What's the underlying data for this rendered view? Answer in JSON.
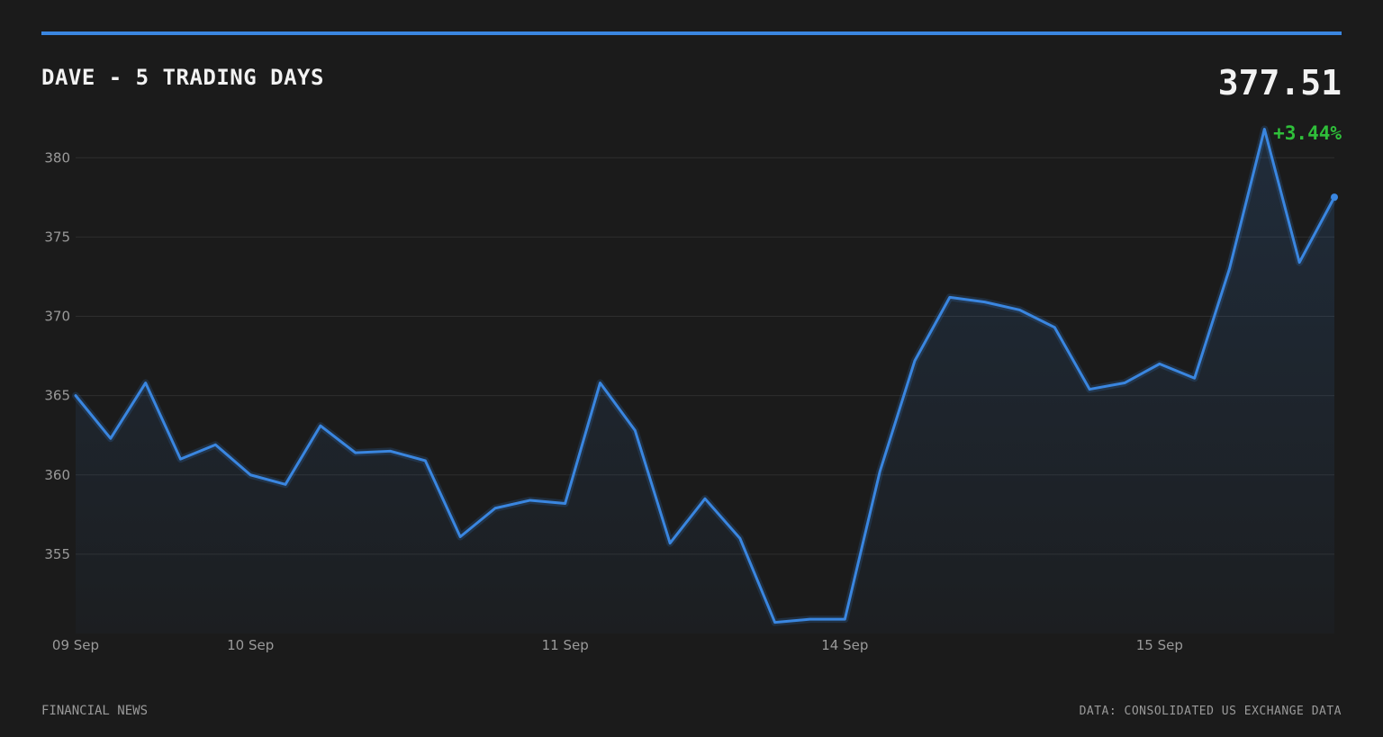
{
  "header": {
    "title": "DAVE - 5 TRADING DAYS",
    "price": "377.51",
    "change": "+3.44%"
  },
  "footer": {
    "source_left": "FINANCIAL NEWS",
    "source_right": "DATA: CONSOLIDATED US EXCHANGE DATA"
  },
  "colors": {
    "accent": "#3a86e0",
    "positive": "#2fbf3a",
    "background": "#1b1b1b"
  },
  "chart_data": {
    "type": "area",
    "grid": true,
    "ylim": [
      350,
      382
    ],
    "yticks": [
      355,
      360,
      365,
      370,
      375,
      380
    ],
    "xticks": [
      {
        "index": 0,
        "label": "09 Sep"
      },
      {
        "index": 5,
        "label": "10 Sep"
      },
      {
        "index": 14,
        "label": "11 Sep"
      },
      {
        "index": 22,
        "label": "14 Sep"
      },
      {
        "index": 31,
        "label": "15 Sep"
      }
    ],
    "values": [
      365.0,
      362.3,
      365.8,
      361.0,
      361.9,
      360.0,
      359.4,
      363.1,
      361.4,
      361.5,
      360.9,
      356.1,
      357.9,
      358.4,
      358.2,
      365.8,
      362.8,
      355.7,
      358.5,
      356.0,
      350.7,
      350.9,
      350.9,
      360.2,
      367.2,
      371.2,
      370.9,
      370.4,
      369.3,
      365.4,
      365.8,
      367.0,
      366.1,
      373.0,
      381.8,
      373.4,
      377.51
    ]
  }
}
